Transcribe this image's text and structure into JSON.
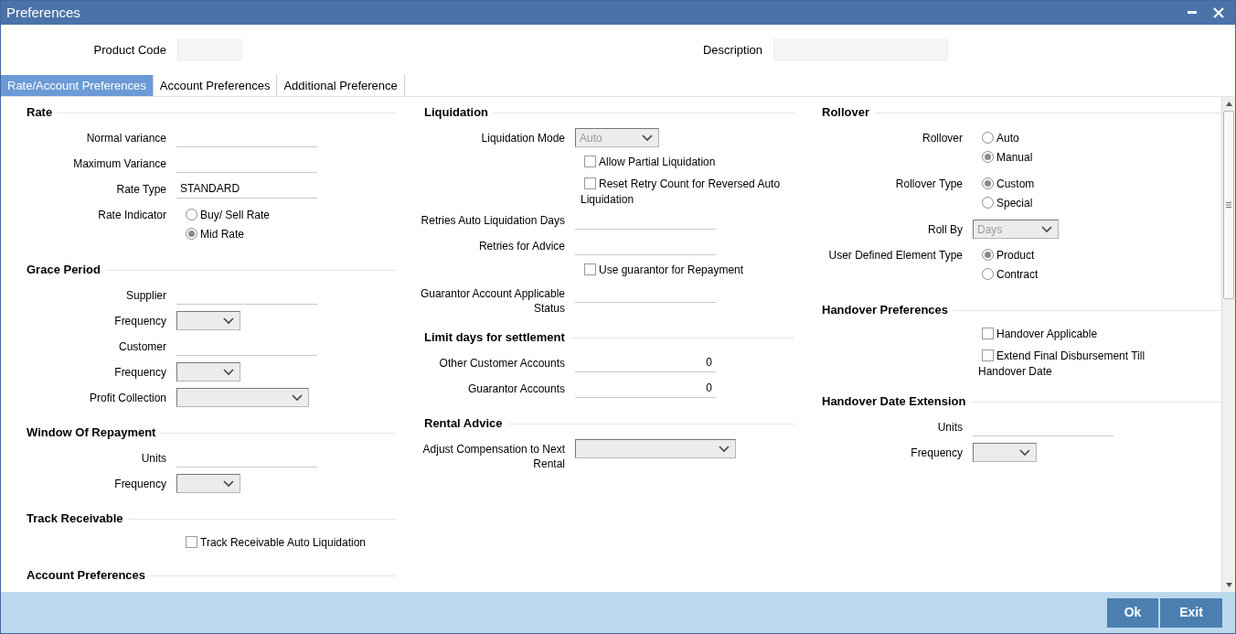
{
  "window": {
    "title": "Preferences"
  },
  "header": [
    {
      "label": "Product Code"
    },
    {
      "label": "Description"
    }
  ],
  "tabs": [
    {
      "label": "Rate/Account Preferences",
      "selected": true
    },
    {
      "label": "Account Preferences",
      "selected": false
    },
    {
      "label": "Additional Preference",
      "selected": false
    }
  ],
  "columns": [
    {
      "sections": [
        {
          "title": "Rate",
          "rows": [
            {
              "kind": "text",
              "label": "Normal variance"
            },
            {
              "kind": "text",
              "label": "Maximum Variance"
            },
            {
              "kind": "text",
              "label": "Rate Type",
              "value": "STANDARD"
            },
            {
              "kind": "radio",
              "label": "Rate Indicator",
              "options": [
                {
                  "label": "Buy/ Sell Rate",
                  "selected": false
                },
                {
                  "label": "Mid Rate",
                  "selected": true
                }
              ]
            }
          ]
        },
        {
          "title": "Grace Period",
          "rows": [
            {
              "kind": "text",
              "label": "Supplier"
            },
            {
              "kind": "select",
              "label": "Frequency"
            },
            {
              "kind": "text",
              "label": "Customer"
            },
            {
              "kind": "select",
              "label": "Frequency"
            },
            {
              "kind": "select",
              "label": "Profit Collection"
            }
          ]
        },
        {
          "title": "Window Of Repayment",
          "rows": [
            {
              "kind": "text",
              "label": "Units"
            },
            {
              "kind": "select",
              "label": "Frequency"
            }
          ]
        },
        {
          "title": "Track Receivable",
          "rows": [
            {
              "kind": "checkbox",
              "label": "Track Receivable Auto Liquidation",
              "checked": false
            }
          ]
        },
        {
          "title": "Account Preferences"
        }
      ]
    },
    {
      "sections": [
        {
          "title": "Liquidation",
          "rows": [
            {
              "kind": "select",
              "label": "Liquidation Mode",
              "value": "Auto",
              "disabled": true
            },
            {
              "kind": "checkbox",
              "label": "Allow Partial Liquidation",
              "checked": false
            },
            {
              "kind": "checkbox",
              "label": "Reset Retry Count for Reversed Auto Liquidation",
              "checked": false
            },
            {
              "kind": "text",
              "label": "Retries Auto Liquidation Days"
            },
            {
              "kind": "text",
              "label": "Retries for Advice"
            },
            {
              "kind": "checkbox",
              "label": "Use guarantor for Repayment",
              "checked": false
            },
            {
              "kind": "text",
              "label": "Guarantor Account Applicable Status"
            }
          ]
        },
        {
          "title": "Limit days for settlement",
          "rows": [
            {
              "kind": "number",
              "label": "Other Customer Accounts",
              "value": "0"
            },
            {
              "kind": "number",
              "label": "Guarantor Accounts",
              "value": "0"
            }
          ]
        },
        {
          "title": "Rental Advice",
          "rows": [
            {
              "kind": "select",
              "label": "Adjust Compensation to Next Rental"
            }
          ]
        }
      ]
    },
    {
      "sections": [
        {
          "title": "Rollover",
          "rows": [
            {
              "kind": "radio",
              "label": "Rollover",
              "options": [
                {
                  "label": "Auto",
                  "selected": false
                },
                {
                  "label": "Manual",
                  "selected": true
                }
              ]
            },
            {
              "kind": "radio",
              "label": "Rollover Type",
              "options": [
                {
                  "label": "Custom",
                  "selected": true
                },
                {
                  "label": "Special",
                  "selected": false
                }
              ]
            },
            {
              "kind": "select",
              "label": "Roll By",
              "value": "Days",
              "disabled": true
            },
            {
              "kind": "radio",
              "label": "User Defined Element Type",
              "options": [
                {
                  "label": "Product",
                  "selected": true
                },
                {
                  "label": "Contract",
                  "selected": false
                }
              ]
            }
          ]
        },
        {
          "title": "Handover Preferences",
          "rows": [
            {
              "kind": "checkbox",
              "label": "Handover Applicable",
              "checked": false
            },
            {
              "kind": "checkbox",
              "label": "Extend Final Disbursement Till Handover Date",
              "checked": false
            }
          ]
        },
        {
          "title": "Handover Date Extension",
          "rows": [
            {
              "kind": "text",
              "label": "Units"
            },
            {
              "kind": "select",
              "label": "Frequency"
            }
          ]
        }
      ]
    }
  ],
  "footer": {
    "buttons": [
      "Ok",
      "Exit"
    ]
  }
}
